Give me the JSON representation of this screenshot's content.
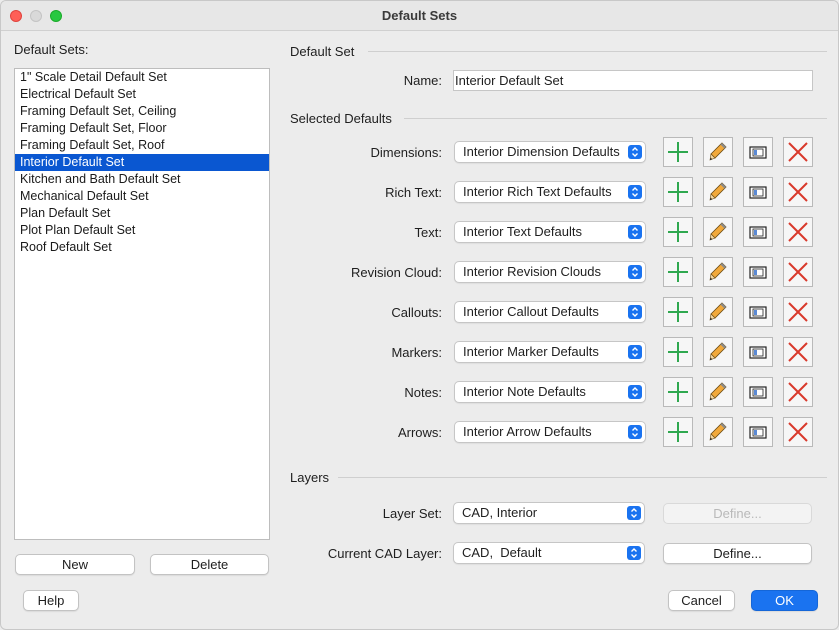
{
  "window": {
    "title": "Default Sets"
  },
  "sidebar": {
    "label": "Default Sets:",
    "items": [
      {
        "label": "1\" Scale Detail Default Set",
        "selected": false
      },
      {
        "label": "Electrical Default Set",
        "selected": false
      },
      {
        "label": "Framing Default Set, Ceiling",
        "selected": false
      },
      {
        "label": "Framing Default Set, Floor",
        "selected": false
      },
      {
        "label": "Framing Default Set, Roof",
        "selected": false
      },
      {
        "label": "Interior Default Set",
        "selected": true
      },
      {
        "label": "Kitchen and Bath Default Set",
        "selected": false
      },
      {
        "label": "Mechanical Default Set",
        "selected": false
      },
      {
        "label": "Plan Default Set",
        "selected": false
      },
      {
        "label": "Plot Plan Default Set",
        "selected": false
      },
      {
        "label": "Roof Default Set",
        "selected": false
      }
    ],
    "new_label": "New",
    "delete_label": "Delete"
  },
  "default_set": {
    "section_title": "Default Set",
    "name_label": "Name:",
    "name_value": "Interior Default Set"
  },
  "selected_defaults": {
    "section_title": "Selected Defaults",
    "rows": [
      {
        "label": "Dimensions:",
        "value": "Interior Dimension Defaults"
      },
      {
        "label": "Rich Text:",
        "value": "Interior Rich Text Defaults"
      },
      {
        "label": "Text:",
        "value": "Interior Text Defaults"
      },
      {
        "label": "Revision Cloud:",
        "value": "Interior Revision Clouds"
      },
      {
        "label": "Callouts:",
        "value": "Interior Callout Defaults"
      },
      {
        "label": "Markers:",
        "value": "Interior Marker Defaults"
      },
      {
        "label": "Notes:",
        "value": "Interior Note Defaults"
      },
      {
        "label": "Arrows:",
        "value": "Interior Arrow Defaults"
      }
    ],
    "row_icons": [
      "plus-icon",
      "pencil-icon",
      "copy-icon",
      "delete-x-icon"
    ]
  },
  "layers": {
    "section_title": "Layers",
    "layer_set_label": "Layer Set:",
    "layer_set_value": "CAD, Interior",
    "layer_set_define_label": "Define...",
    "current_cad_layer_label": "Current CAD Layer:",
    "current_cad_layer_value": "CAD,  Default",
    "current_cad_define_label": "Define..."
  },
  "footer": {
    "help_label": "Help",
    "cancel_label": "Cancel",
    "ok_label": "OK"
  },
  "colors": {
    "accent": "#1a73f0",
    "selection": "#0a57d1",
    "plus": "#2fa84f",
    "delete": "#d9392b",
    "pencil": "#f2a93b"
  }
}
